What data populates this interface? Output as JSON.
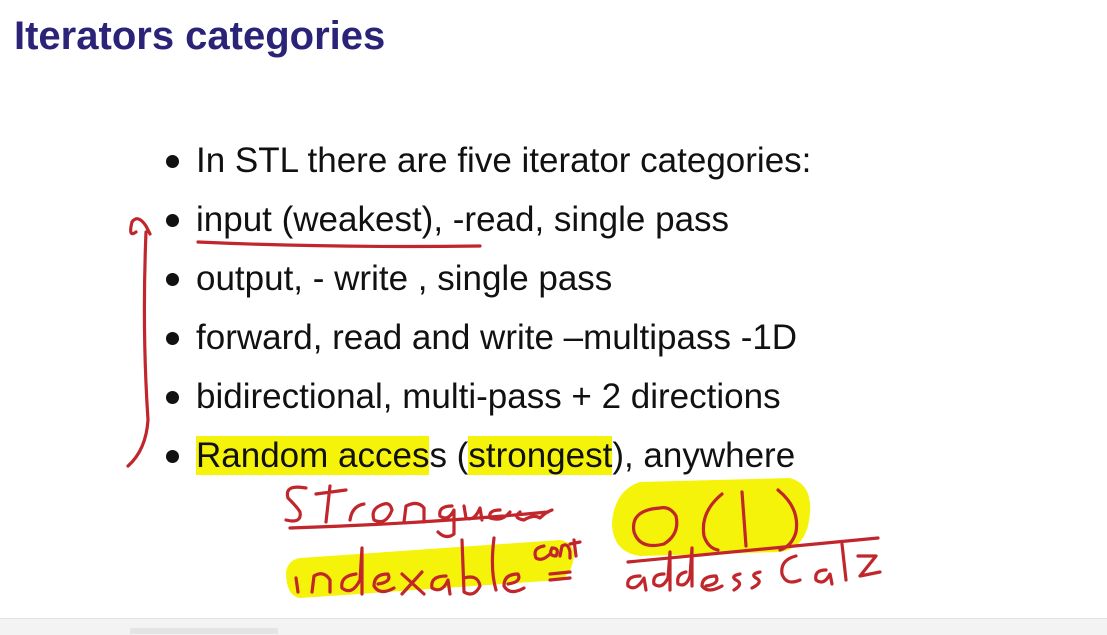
{
  "slide": {
    "title": "Iterators categories",
    "bullets": [
      {
        "parts": [
          {
            "text": "In STL there are five iterator categories:",
            "hl": false
          }
        ]
      },
      {
        "parts": [
          {
            "text": "input   (weakest),  -read, single pass",
            "hl": false
          }
        ]
      },
      {
        "parts": [
          {
            "text": "output,  - write , single pass",
            "hl": false
          }
        ]
      },
      {
        "parts": [
          {
            "text": "forward,  read and write –multipass -1D",
            "hl": false
          }
        ]
      },
      {
        "parts": [
          {
            "text": "bidirectional, multi-pass + 2 directions",
            "hl": false
          }
        ]
      },
      {
        "parts": [
          {
            "text": "Random  acces",
            "hl": true
          },
          {
            "text": "s  (",
            "hl": false
          },
          {
            "text": "strongest",
            "hl": true
          },
          {
            "text": "), anywhere",
            "hl": false
          }
        ]
      }
    ]
  },
  "handwriting": {
    "ink_color": "#c0262b",
    "highlight_color": "#f6f30a",
    "notes": [
      "Strongest",
      "O(1)",
      "indexable cont",
      "address calc"
    ]
  }
}
